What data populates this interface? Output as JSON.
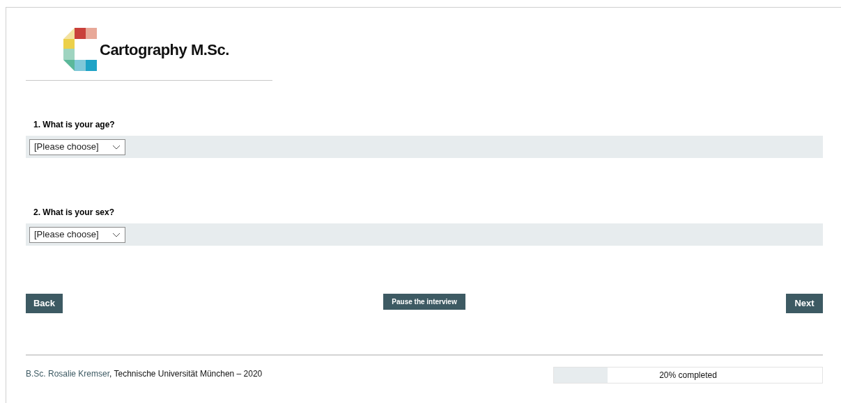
{
  "logo": {
    "text": "Cartography M.Sc."
  },
  "questions": [
    {
      "label": "1. What is your age?",
      "select": {
        "value": "[Please choose]"
      }
    },
    {
      "label": "2. What is your sex?",
      "select": {
        "value": "[Please choose]"
      }
    }
  ],
  "buttons": {
    "back": "Back",
    "pause": "Pause the interview",
    "next": "Next"
  },
  "footer": {
    "author": "B.Sc. Rosalie Kremser",
    "rest": ", Technische Universität München – 2020"
  },
  "progress": {
    "level": 0.2,
    "text": "20% completed"
  }
}
